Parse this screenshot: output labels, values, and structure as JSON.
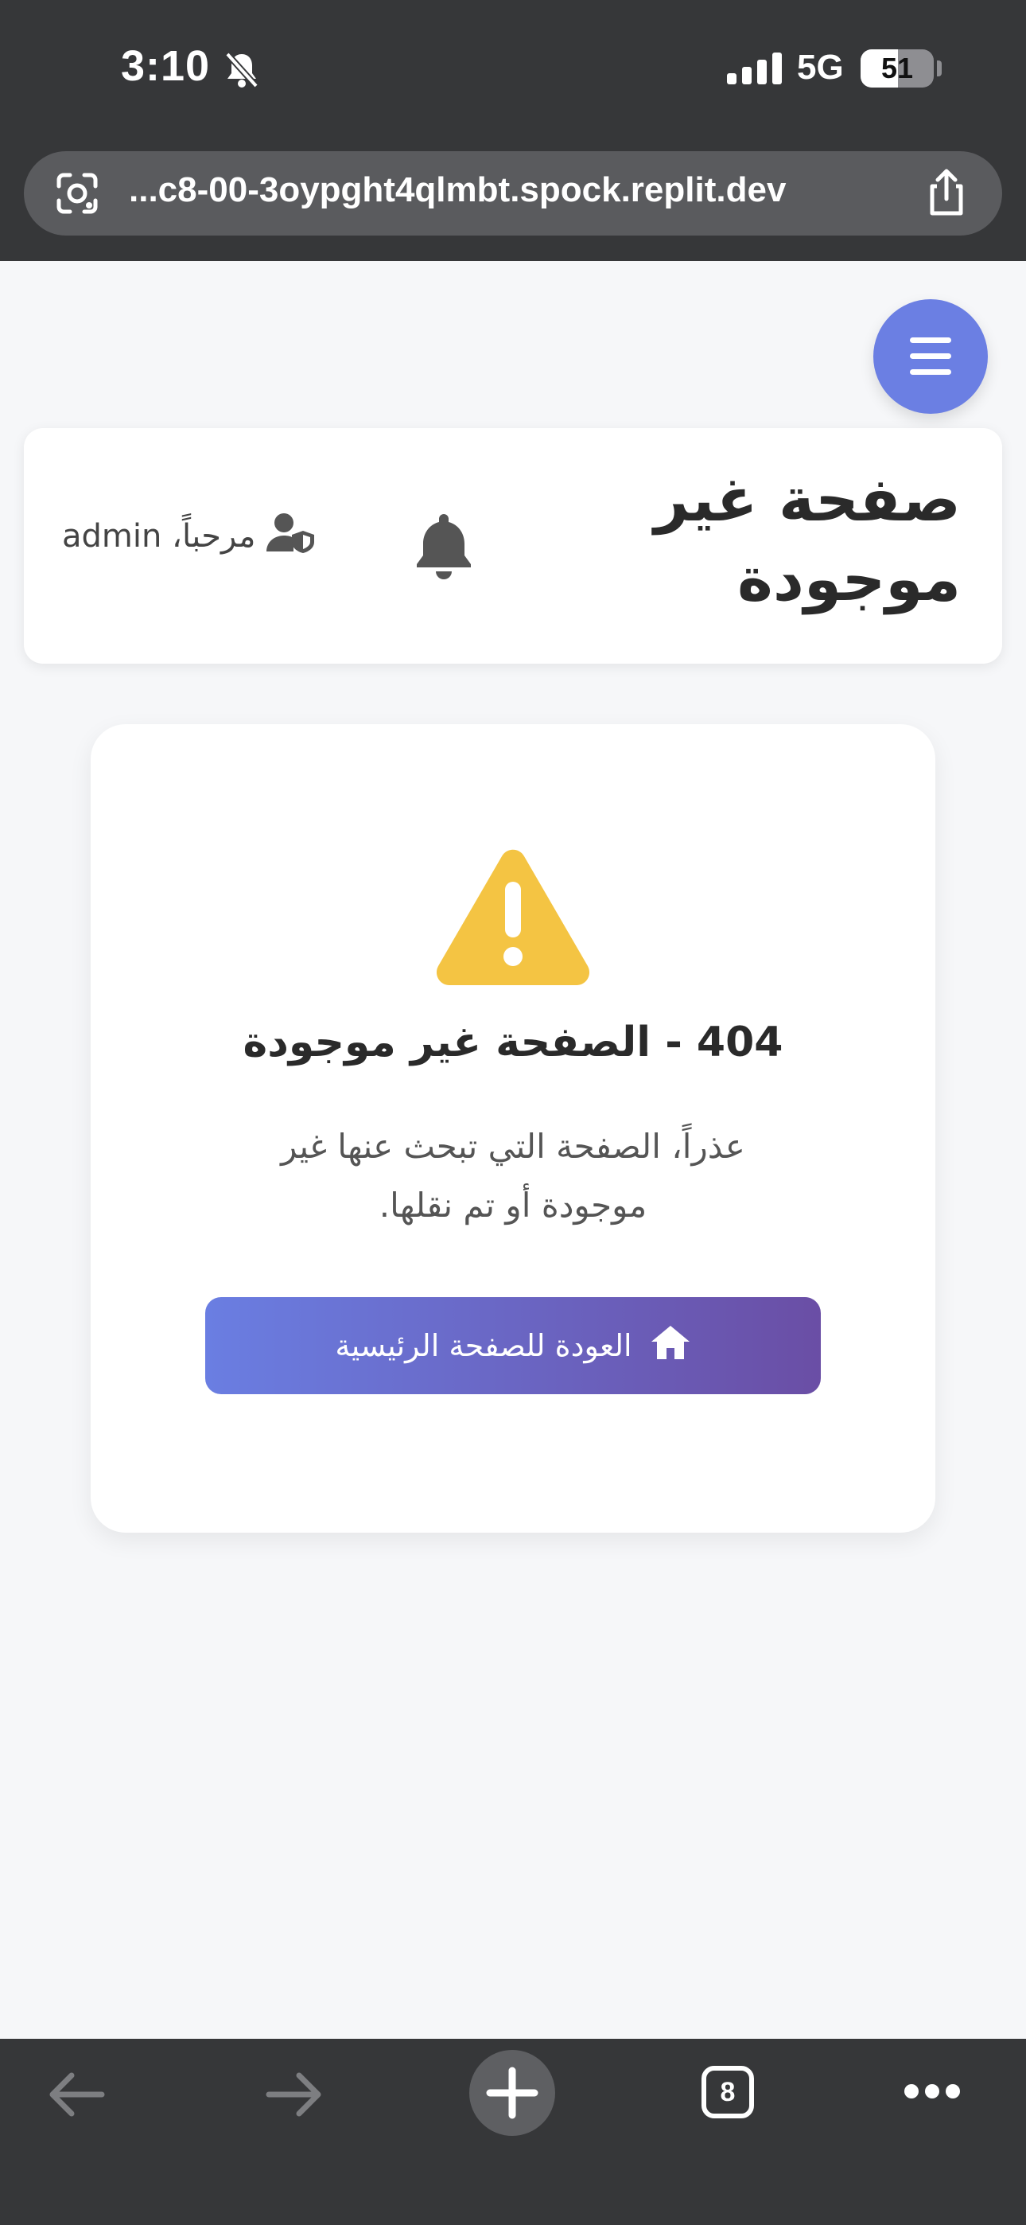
{
  "status_bar": {
    "time": "3:10",
    "network": "5G",
    "battery_percent": "51",
    "battery_level": 0.51,
    "icons": [
      "bell-slash-icon",
      "signal-bars-icon",
      "battery-icon"
    ]
  },
  "browser": {
    "url": "...c8-00-3oypght4qlmbt.spock.replit.dev",
    "icons": [
      "google-lens-icon",
      "share-icon"
    ],
    "toolbar": {
      "tab_count": "8",
      "icons": [
        "back-arrow-icon",
        "forward-arrow-icon",
        "new-tab-plus-icon",
        "tabs-icon",
        "more-dots-icon"
      ]
    }
  },
  "header": {
    "title": "صفحة غير موجودة",
    "welcome": "مرحباً، admin",
    "icons": [
      "hamburger-menu-icon",
      "bell-icon",
      "user-shield-icon"
    ]
  },
  "error": {
    "title": "404 - الصفحة غير موجودة",
    "message": "عذراً، الصفحة التي تبحث عنها غير موجودة أو تم نقلها.",
    "button_label": "العودة للصفحة الرئيسية",
    "icons": [
      "warning-triangle-icon",
      "home-icon"
    ]
  },
  "colors": {
    "accent": "#6b7fe3",
    "button_gradient_start": "#6a7ee2",
    "button_gradient_end": "#6a4ea5",
    "warning": "#f4c443",
    "chrome": "#363739"
  }
}
